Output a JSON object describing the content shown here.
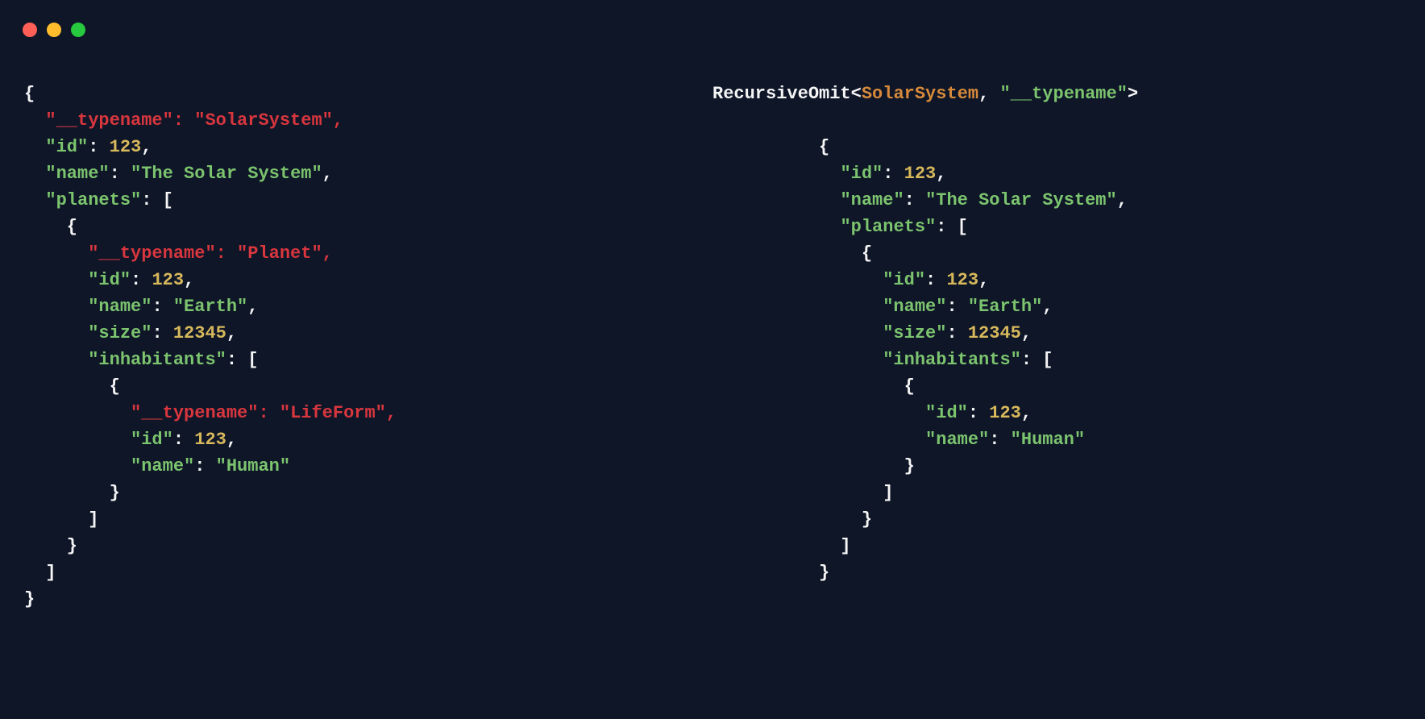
{
  "colors": {
    "background": "#0e1628",
    "white": "#f5f5f5",
    "green": "#7cc46e",
    "yellow": "#d7b85b",
    "red": "#d9363e",
    "orange": "#d88a3a"
  },
  "traffic_lights": [
    "red",
    "yellow",
    "green"
  ],
  "left_pane": {
    "lines": [
      [
        {
          "t": "{",
          "c": "w"
        }
      ],
      [
        {
          "t": "  ",
          "c": "w"
        },
        {
          "t": "\"__typename\": \"SolarSystem\",",
          "c": "r"
        }
      ],
      [
        {
          "t": "  ",
          "c": "w"
        },
        {
          "t": "\"id\"",
          "c": "g"
        },
        {
          "t": ": ",
          "c": "w"
        },
        {
          "t": "123",
          "c": "y"
        },
        {
          "t": ",",
          "c": "w"
        }
      ],
      [
        {
          "t": "  ",
          "c": "w"
        },
        {
          "t": "\"name\"",
          "c": "g"
        },
        {
          "t": ": ",
          "c": "w"
        },
        {
          "t": "\"The Solar System\"",
          "c": "g"
        },
        {
          "t": ",",
          "c": "w"
        }
      ],
      [
        {
          "t": "  ",
          "c": "w"
        },
        {
          "t": "\"planets\"",
          "c": "g"
        },
        {
          "t": ": [",
          "c": "w"
        }
      ],
      [
        {
          "t": "    {",
          "c": "w"
        }
      ],
      [
        {
          "t": "      ",
          "c": "w"
        },
        {
          "t": "\"__typename\": \"Planet\",",
          "c": "r"
        }
      ],
      [
        {
          "t": "      ",
          "c": "w"
        },
        {
          "t": "\"id\"",
          "c": "g"
        },
        {
          "t": ": ",
          "c": "w"
        },
        {
          "t": "123",
          "c": "y"
        },
        {
          "t": ",",
          "c": "w"
        }
      ],
      [
        {
          "t": "      ",
          "c": "w"
        },
        {
          "t": "\"name\"",
          "c": "g"
        },
        {
          "t": ": ",
          "c": "w"
        },
        {
          "t": "\"Earth\"",
          "c": "g"
        },
        {
          "t": ",",
          "c": "w"
        }
      ],
      [
        {
          "t": "      ",
          "c": "w"
        },
        {
          "t": "\"size\"",
          "c": "g"
        },
        {
          "t": ": ",
          "c": "w"
        },
        {
          "t": "12345",
          "c": "y"
        },
        {
          "t": ",",
          "c": "w"
        }
      ],
      [
        {
          "t": "      ",
          "c": "w"
        },
        {
          "t": "\"inhabitants\"",
          "c": "g"
        },
        {
          "t": ": [",
          "c": "w"
        }
      ],
      [
        {
          "t": "        {",
          "c": "w"
        }
      ],
      [
        {
          "t": "          ",
          "c": "w"
        },
        {
          "t": "\"__typename\": \"LifeForm\",",
          "c": "r"
        }
      ],
      [
        {
          "t": "          ",
          "c": "w"
        },
        {
          "t": "\"id\"",
          "c": "g"
        },
        {
          "t": ": ",
          "c": "w"
        },
        {
          "t": "123",
          "c": "y"
        },
        {
          "t": ",",
          "c": "w"
        }
      ],
      [
        {
          "t": "          ",
          "c": "w"
        },
        {
          "t": "\"name\"",
          "c": "g"
        },
        {
          "t": ": ",
          "c": "w"
        },
        {
          "t": "\"Human\"",
          "c": "g"
        }
      ],
      [
        {
          "t": "        }",
          "c": "w"
        }
      ],
      [
        {
          "t": "      ]",
          "c": "w"
        }
      ],
      [
        {
          "t": "    }",
          "c": "w"
        }
      ],
      [
        {
          "t": "  ]",
          "c": "w"
        }
      ],
      [
        {
          "t": "}",
          "c": "w"
        }
      ]
    ]
  },
  "right_pane": {
    "header": [
      {
        "t": "RecursiveOmit",
        "c": "w"
      },
      {
        "t": "<",
        "c": "w"
      },
      {
        "t": "SolarSystem",
        "c": "o"
      },
      {
        "t": ", ",
        "c": "w"
      },
      {
        "t": "\"__typename\"",
        "c": "g"
      },
      {
        "t": ">",
        "c": "w"
      }
    ],
    "lines": [
      [
        {
          "t": "          {",
          "c": "w"
        }
      ],
      [
        {
          "t": "            ",
          "c": "w"
        },
        {
          "t": "\"id\"",
          "c": "g"
        },
        {
          "t": ": ",
          "c": "w"
        },
        {
          "t": "123",
          "c": "y"
        },
        {
          "t": ",",
          "c": "w"
        }
      ],
      [
        {
          "t": "            ",
          "c": "w"
        },
        {
          "t": "\"name\"",
          "c": "g"
        },
        {
          "t": ": ",
          "c": "w"
        },
        {
          "t": "\"The Solar System\"",
          "c": "g"
        },
        {
          "t": ",",
          "c": "w"
        }
      ],
      [
        {
          "t": "            ",
          "c": "w"
        },
        {
          "t": "\"planets\"",
          "c": "g"
        },
        {
          "t": ": [",
          "c": "w"
        }
      ],
      [
        {
          "t": "              {",
          "c": "w"
        }
      ],
      [
        {
          "t": "                ",
          "c": "w"
        },
        {
          "t": "\"id\"",
          "c": "g"
        },
        {
          "t": ": ",
          "c": "w"
        },
        {
          "t": "123",
          "c": "y"
        },
        {
          "t": ",",
          "c": "w"
        }
      ],
      [
        {
          "t": "                ",
          "c": "w"
        },
        {
          "t": "\"name\"",
          "c": "g"
        },
        {
          "t": ": ",
          "c": "w"
        },
        {
          "t": "\"Earth\"",
          "c": "g"
        },
        {
          "t": ",",
          "c": "w"
        }
      ],
      [
        {
          "t": "                ",
          "c": "w"
        },
        {
          "t": "\"size\"",
          "c": "g"
        },
        {
          "t": ": ",
          "c": "w"
        },
        {
          "t": "12345",
          "c": "y"
        },
        {
          "t": ",",
          "c": "w"
        }
      ],
      [
        {
          "t": "                ",
          "c": "w"
        },
        {
          "t": "\"inhabitants\"",
          "c": "g"
        },
        {
          "t": ": [",
          "c": "w"
        }
      ],
      [
        {
          "t": "                  {",
          "c": "w"
        }
      ],
      [
        {
          "t": "                    ",
          "c": "w"
        },
        {
          "t": "\"id\"",
          "c": "g"
        },
        {
          "t": ": ",
          "c": "w"
        },
        {
          "t": "123",
          "c": "y"
        },
        {
          "t": ",",
          "c": "w"
        }
      ],
      [
        {
          "t": "                    ",
          "c": "w"
        },
        {
          "t": "\"name\"",
          "c": "g"
        },
        {
          "t": ": ",
          "c": "w"
        },
        {
          "t": "\"Human\"",
          "c": "g"
        }
      ],
      [
        {
          "t": "                  }",
          "c": "w"
        }
      ],
      [
        {
          "t": "                ]",
          "c": "w"
        }
      ],
      [
        {
          "t": "              }",
          "c": "w"
        }
      ],
      [
        {
          "t": "            ]",
          "c": "w"
        }
      ],
      [
        {
          "t": "          }",
          "c": "w"
        }
      ]
    ]
  }
}
